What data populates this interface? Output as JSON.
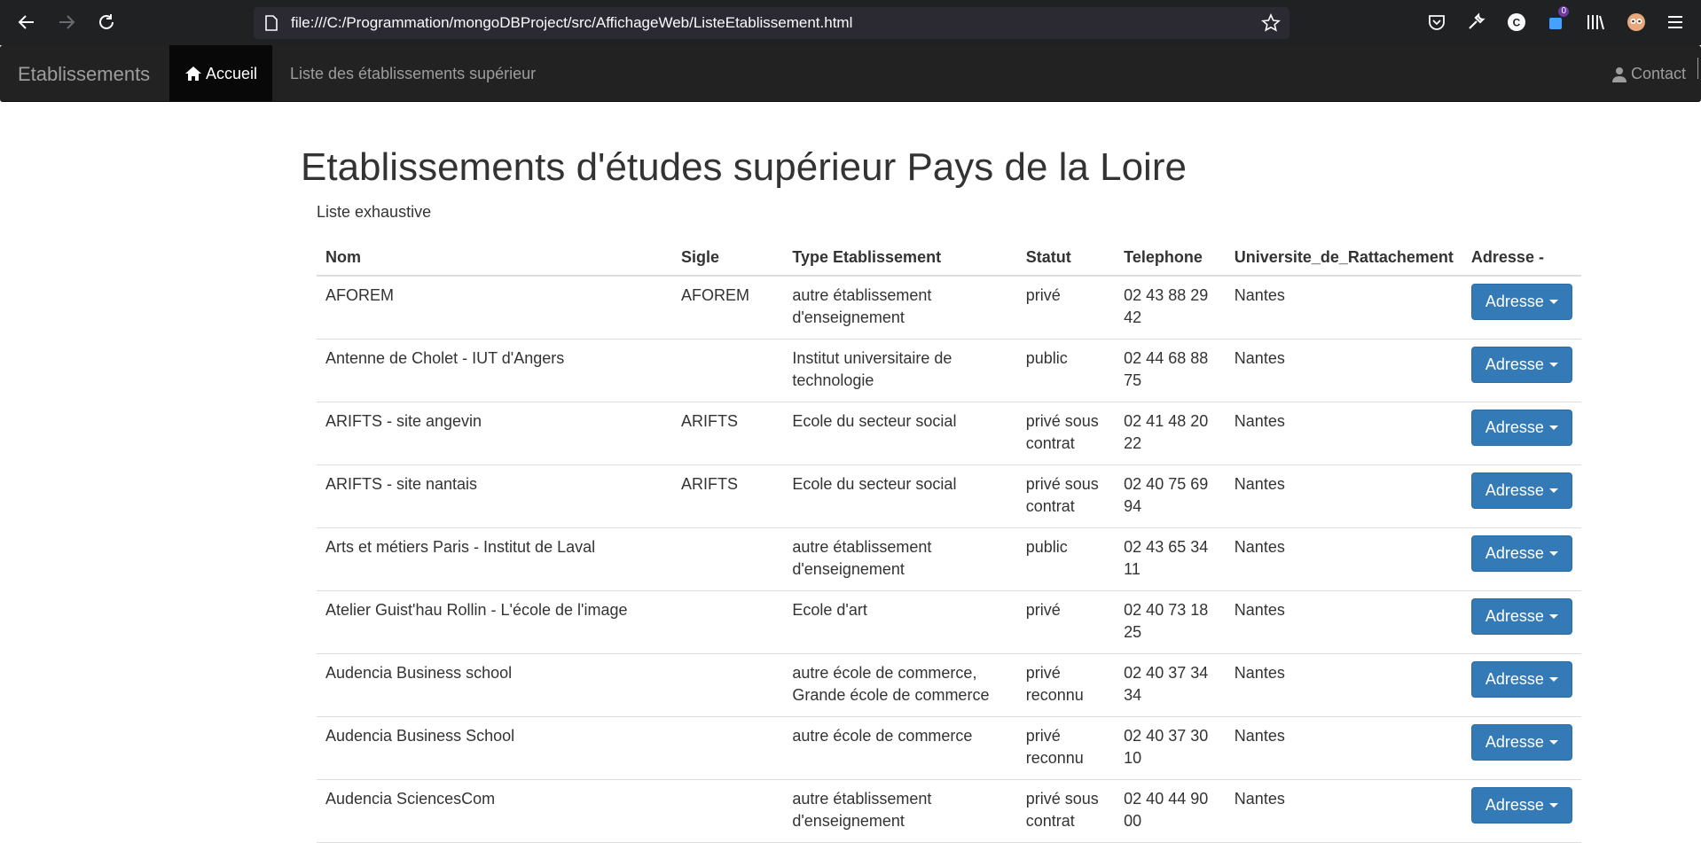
{
  "browser": {
    "url": "file:///C:/Programmation/mongoDBProject/src/AffichageWeb/ListeEtablissement.html",
    "extension_badge": "0",
    "icons": [
      "back-arrow-icon",
      "forward-arrow-icon",
      "reload-icon",
      "page-icon",
      "star-icon",
      "pocket-icon",
      "wrench-icon",
      "c-icon",
      "extension-icon",
      "library-icon",
      "avatar-icon",
      "menu-icon"
    ]
  },
  "navbar": {
    "brand": "Etablissements",
    "home_label": "Accueil",
    "list_label": "Liste des établissements supérieur",
    "contact_label": "Contact"
  },
  "main": {
    "title": "Etablissements d'études supérieur Pays de la Loire",
    "caption": "Liste exhaustive"
  },
  "table": {
    "headers": {
      "nom": "Nom",
      "sigle": "Sigle",
      "type": "Type Etablissement",
      "statut": "Statut",
      "telephone": "Telephone",
      "universite": "Universite_de_Rattachement",
      "adresse": "Adresse -"
    },
    "button_label": "Adresse",
    "rows": [
      {
        "nom": "AFOREM",
        "sigle": "AFOREM",
        "type": "autre établissement d'enseignement",
        "statut": "privé",
        "telephone": "02 43 88 29 42",
        "universite": "Nantes"
      },
      {
        "nom": "Antenne de Cholet - IUT d'Angers",
        "sigle": "",
        "type": "Institut universitaire de technologie",
        "statut": "public",
        "telephone": "02 44 68 88 75",
        "universite": "Nantes"
      },
      {
        "nom": "ARIFTS - site angevin",
        "sigle": "ARIFTS",
        "type": "Ecole du secteur social",
        "statut": "privé sous contrat",
        "telephone": "02 41 48 20 22",
        "universite": "Nantes"
      },
      {
        "nom": "ARIFTS - site nantais",
        "sigle": "ARIFTS",
        "type": "Ecole du secteur social",
        "statut": "privé sous contrat",
        "telephone": "02 40 75 69 94",
        "universite": "Nantes"
      },
      {
        "nom": "Arts et métiers Paris - Institut de Laval",
        "sigle": "",
        "type": "autre établissement d'enseignement",
        "statut": "public",
        "telephone": "02 43 65 34 11",
        "universite": "Nantes"
      },
      {
        "nom": "Atelier Guist'hau Rollin - L'école de l'image",
        "sigle": "",
        "type": "Ecole d'art",
        "statut": "privé",
        "telephone": "02 40 73 18 25",
        "universite": "Nantes"
      },
      {
        "nom": "Audencia Business school",
        "sigle": "",
        "type": "autre école de commerce, Grande école de commerce",
        "statut": "privé reconnu",
        "telephone": "02 40 37 34 34",
        "universite": "Nantes"
      },
      {
        "nom": "Audencia Business School",
        "sigle": "",
        "type": "autre école de commerce",
        "statut": "privé reconnu",
        "telephone": "02 40 37 30 10",
        "universite": "Nantes"
      },
      {
        "nom": "Audencia SciencesCom",
        "sigle": "",
        "type": "autre établissement d'enseignement",
        "statut": "privé sous contrat",
        "telephone": "02 40 44 90 00",
        "universite": "Nantes"
      }
    ]
  }
}
